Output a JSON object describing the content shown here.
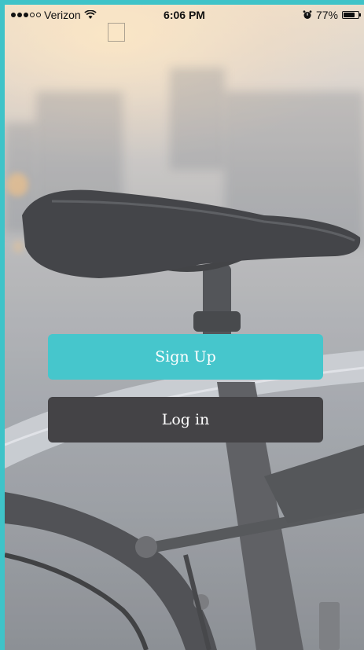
{
  "status_bar": {
    "carrier": "Verizon",
    "signal_bars_filled": 3,
    "signal_bars_total": 5,
    "wifi_icon": "wifi-icon",
    "time": "6:06 PM",
    "alarm_icon": "alarm-icon",
    "battery_percent": "77%",
    "battery_level": 0.77
  },
  "buttons": {
    "signup_label": "Sign Up",
    "login_label": "Log in"
  },
  "colors": {
    "accent": "#46c6cc",
    "login_button": "#444346",
    "frame": "#3fc3c8"
  },
  "background": {
    "image": "bicycle-seat-photo"
  }
}
